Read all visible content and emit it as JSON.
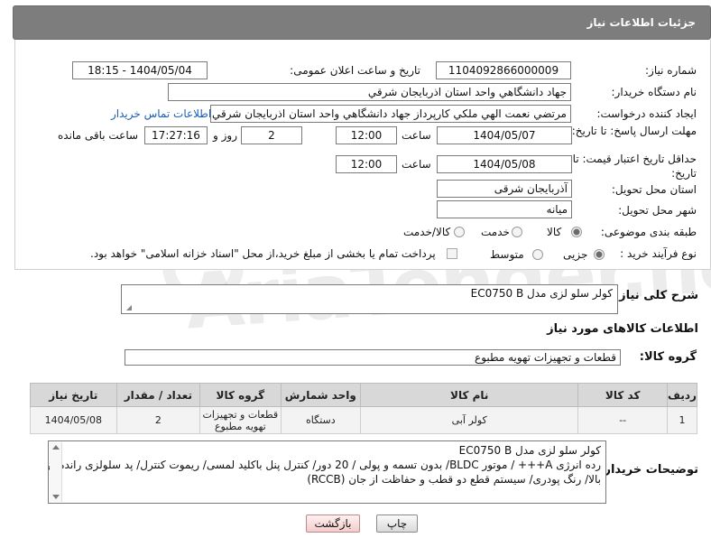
{
  "header": {
    "title": "جزئیات اطلاعات نیاز"
  },
  "form": {
    "need_number_label": "شماره نیاز:",
    "need_number": "1104092866000009",
    "announce_label": "تاریخ و ساعت اعلان عمومی:",
    "announce_value": "1404/05/04 - 18:15",
    "buyer_org_label": "نام دستگاه خریدار:",
    "buyer_org": "جهاد دانشگاهي واحد استان اذربايجان شرقي",
    "requester_label": "ایجاد کننده درخواست:",
    "requester": "مرتضي نعمت الهي ملکي کارپرداز جهاد دانشگاهي واحد استان اذربايجان شرقي",
    "contact_link": "اطلاعات تماس خریدار",
    "deadline_label": "مهلت ارسال پاسخ: تا تاریخ:",
    "deadline_date": "1404/05/07",
    "time_label": "ساعت",
    "deadline_time": "12:00",
    "days_value": "2",
    "days_label": "روز و",
    "remaining_time": "17:27:16",
    "remaining_label": "ساعت باقی مانده",
    "validity_label": "حداقل تاریخ اعتبار قیمت: تا تاریخ:",
    "validity_date": "1404/05/08",
    "validity_time": "12:00",
    "province_label": "استان محل تحویل:",
    "province": "آذربایجان شرقی",
    "city_label": "شهر محل تحویل:",
    "city": "میانه",
    "category_label": "طبقه بندی موضوعی:",
    "category_options": [
      "کالا",
      "خدمت",
      "کالا/خدمت"
    ],
    "category_selected": "کالا",
    "process_label": "نوع فرآیند خرید :",
    "process_options": [
      "جزیی",
      "متوسط"
    ],
    "process_selected": "جزیی",
    "payment_note": "پرداخت تمام یا بخشی از مبلغ خرید،از محل \"اسناد خزانه اسلامی\" خواهد بود."
  },
  "summary": {
    "label": "شرح کلی نیاز:",
    "text": "کولر سلو لزی   مدل EC0750 B"
  },
  "goods": {
    "section_title": "اطلاعات کالاهای مورد نیاز",
    "group_label": "گروه کالا:",
    "group_value": "قطعات و تجهیزات تهویه مطبوع",
    "columns": [
      "ردیف",
      "کد کالا",
      "نام کالا",
      "واحد شمارش",
      "گروه کالا",
      "تعداد / مقدار",
      "تاریخ نیاز"
    ],
    "rows": [
      {
        "row": "1",
        "code": "--",
        "name": "کولر آبی",
        "unit": "دستگاه",
        "group": "قطعات و تجهیزات تهویه مطبوع",
        "qty": "2",
        "date": "1404/05/08"
      }
    ]
  },
  "buyer_notes": {
    "label": "توضیحات خریدار:",
    "line1": "کولر سلو لزی   مدل EC0750 B",
    "line2": "رده انرژی A+++ / موتور BLDC/ بدون تسمه و پولی / 20 دور/ کنترل پنل باکلید لمسی/ ریموت کنترل/ پد سلولزی  راندمان",
    "line3": "بالا/ رنگ پودری/ سیستم قطع دو قطب  و حفاظت از جان (RCCB)"
  },
  "buttons": {
    "print": "چاپ",
    "back": "بازگشت"
  },
  "watermark": "AriaTender.neT"
}
